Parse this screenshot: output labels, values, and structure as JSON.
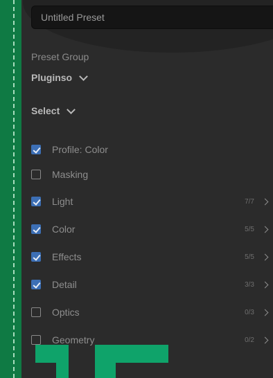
{
  "preset": {
    "name_placeholder": "Untitled Preset"
  },
  "preset_group": {
    "label": "Preset Group",
    "value": "Pluginso"
  },
  "select": {
    "label": "Select"
  },
  "items": [
    {
      "label": "Profile: Color",
      "checked": true,
      "count": ""
    },
    {
      "label": "Masking",
      "checked": false,
      "count": ""
    },
    {
      "label": "Light",
      "checked": true,
      "count": "7/7"
    },
    {
      "label": "Color",
      "checked": true,
      "count": "5/5"
    },
    {
      "label": "Effects",
      "checked": true,
      "count": "5/5"
    },
    {
      "label": "Detail",
      "checked": true,
      "count": "3/3"
    },
    {
      "label": "Optics",
      "checked": false,
      "count": "0/3"
    },
    {
      "label": "Geometry",
      "checked": false,
      "count": "0/2"
    }
  ],
  "colors": {
    "accent_checkbox": "#3c6fb5",
    "brand_green": "#0fa36a",
    "panel_bg": "#2b2b2b"
  }
}
